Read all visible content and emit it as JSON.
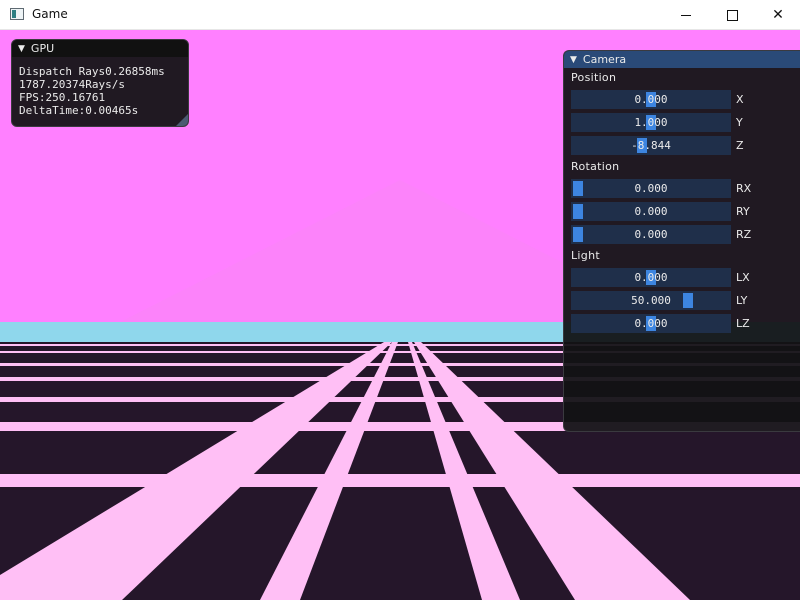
{
  "window": {
    "title": "Game",
    "icon": "app-window-icon",
    "buttons": {
      "minimize": "minimize-icon",
      "maximize": "maximize-icon",
      "close": "close-icon"
    }
  },
  "colors": {
    "sky": "#ff80ff",
    "horizon": "#8fd7ec",
    "floor": "#25162a",
    "grid": "#ffbff5",
    "panel_bg": "#121214",
    "camera_header": "#2a4a78",
    "slider_bg": "#1f2f4a",
    "slider_grab": "#3d85e0"
  },
  "gpu_panel": {
    "title": "GPU",
    "lines": [
      "Dispatch Rays0.26858ms",
      "1787.20374Rays/s",
      "FPS:250.16761",
      "DeltaTime:0.00465s"
    ]
  },
  "camera_panel": {
    "title": "Camera",
    "position": {
      "label": "Position",
      "fields": [
        {
          "axis": "X",
          "value": "0.000",
          "fraction": 0.5
        },
        {
          "axis": "Y",
          "value": "1.000",
          "fraction": 0.5
        },
        {
          "axis": "Z",
          "value": "-8.844",
          "fraction": 0.44
        }
      ]
    },
    "rotation": {
      "label": "Rotation",
      "fields": [
        {
          "axis": "RX",
          "value": "0.000",
          "fraction": 0.0
        },
        {
          "axis": "RY",
          "value": "0.000",
          "fraction": 0.0
        },
        {
          "axis": "RZ",
          "value": "0.000",
          "fraction": 0.0
        }
      ]
    },
    "light": {
      "label": "Light",
      "fields": [
        {
          "axis": "LX",
          "value": "0.000",
          "fraction": 0.5
        },
        {
          "axis": "LY",
          "value": "50.000",
          "fraction": 0.75
        },
        {
          "axis": "LZ",
          "value": "0.000",
          "fraction": 0.5
        }
      ]
    }
  }
}
